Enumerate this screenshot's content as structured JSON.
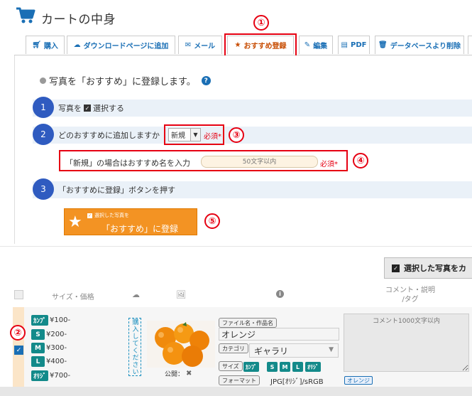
{
  "header": {
    "title": "カートの中身"
  },
  "tabs": [
    {
      "label": "購入",
      "icon": "cart-icon"
    },
    {
      "label": "ダウンロードページに追加",
      "icon": "cloud-download-icon"
    },
    {
      "label": "メール",
      "icon": "envelope-icon"
    },
    {
      "label": "おすすめ登録",
      "icon": "star-icon",
      "active": true
    },
    {
      "label": "編集",
      "icon": "pencil-icon"
    },
    {
      "label": "PDF",
      "icon": "pdf-file-icon"
    },
    {
      "label": "データベースより削除",
      "icon": "trash-icon"
    }
  ],
  "callouts": [
    "①",
    "②",
    "③",
    "④",
    "⑤"
  ],
  "panel": {
    "intro": "写真を「おすすめ」に登録します。",
    "help": "?",
    "steps": [
      {
        "num": "1",
        "text_before": "写真を",
        "text_after": "選択する"
      },
      {
        "num": "2",
        "text": "どのおすすめに追加しますか"
      },
      {
        "num": "3",
        "text": "「おすすめに登録」ボタンを押す"
      }
    ],
    "select_value": "新規",
    "required_label": "必須",
    "required_mark": "*",
    "name_label": "「新規」の場合はおすすめ名を入力",
    "name_placeholder": "50文字以内",
    "register_small": "選択した写真を",
    "register_main": "「おすすめ」に登録"
  },
  "selection_button": {
    "label": "選択した写真をカ"
  },
  "table_header": {
    "size_price": "サイズ・価格",
    "comment_line1": "コメント・説明",
    "comment_line2": "/タグ"
  },
  "row": {
    "prices": [
      {
        "badge": "ｶﾝﾌﾟ",
        "value": "¥100-"
      },
      {
        "badge": "S",
        "value": "¥200-"
      },
      {
        "badge": "M",
        "value": "¥300-"
      },
      {
        "badge": "L",
        "value": "¥400-"
      },
      {
        "badge": "ｵﾘｼﾞ",
        "value": "¥700-"
      }
    ],
    "buy_text": "購入してください",
    "public_label": "公開：",
    "public_mark": "✖",
    "filename_label": "ファイル名・作品名",
    "filename": "オレンジ",
    "category_label": "カテゴリ",
    "category": "ギャラリ",
    "size_label": "サイズ",
    "size_badges": [
      "ｶﾝﾌﾟ",
      "S",
      "M",
      "L",
      "ｵﾘｼﾞ"
    ],
    "format_label": "フォーマット",
    "format_value": "JPG[ｵﾘｼﾞ]/sRGB",
    "comment_placeholder": "コメント1000文字以内",
    "tag": "オレンジ"
  },
  "colors": {
    "accent": "#1a6fb5",
    "highlight": "#e60012",
    "button_orange": "#f39323",
    "step_blue": "#2f5bc0",
    "badge_teal": "#138a8a"
  }
}
